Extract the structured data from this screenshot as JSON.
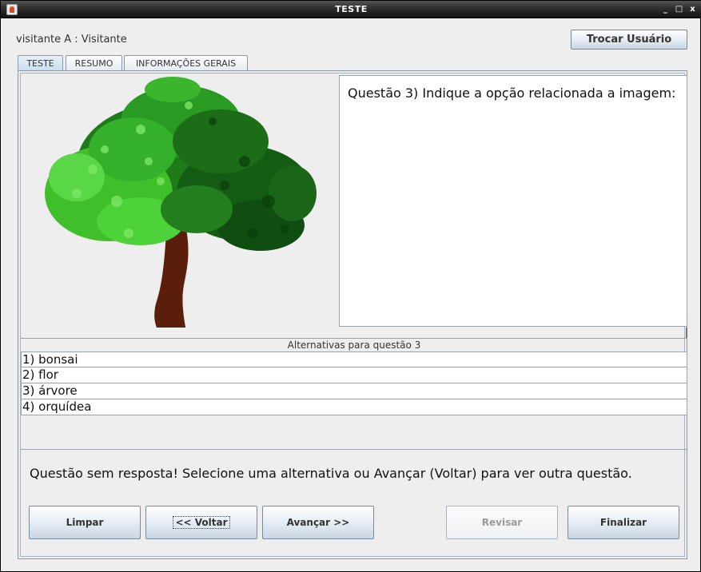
{
  "window": {
    "title": "TESTE",
    "controls": [
      "_",
      "□",
      "x"
    ]
  },
  "user": {
    "label": "visitante A : Visitante",
    "switch_label": "Trocar Usuário"
  },
  "tabs": [
    {
      "label": "TESTE"
    },
    {
      "label": "RESUMO"
    },
    {
      "label": "INFORMAÇÕES GERAIS"
    }
  ],
  "question": {
    "text": "Questão 3) Indique a opção relacionada a imagem:",
    "image": "tree-illustration"
  },
  "alternatives": {
    "header": "Alternativas para questão 3",
    "items": [
      "1) bonsai",
      "2) flor",
      "3) árvore",
      "4) orquídea"
    ]
  },
  "status": {
    "text": "Questão sem resposta! Selecione uma alternativa ou Avançar (Voltar) para ver outra questão."
  },
  "buttons": {
    "clear": "Limpar",
    "back": "<< Voltar",
    "next": "Avançar >>",
    "review": "Revisar",
    "finish": "Finalizar"
  }
}
